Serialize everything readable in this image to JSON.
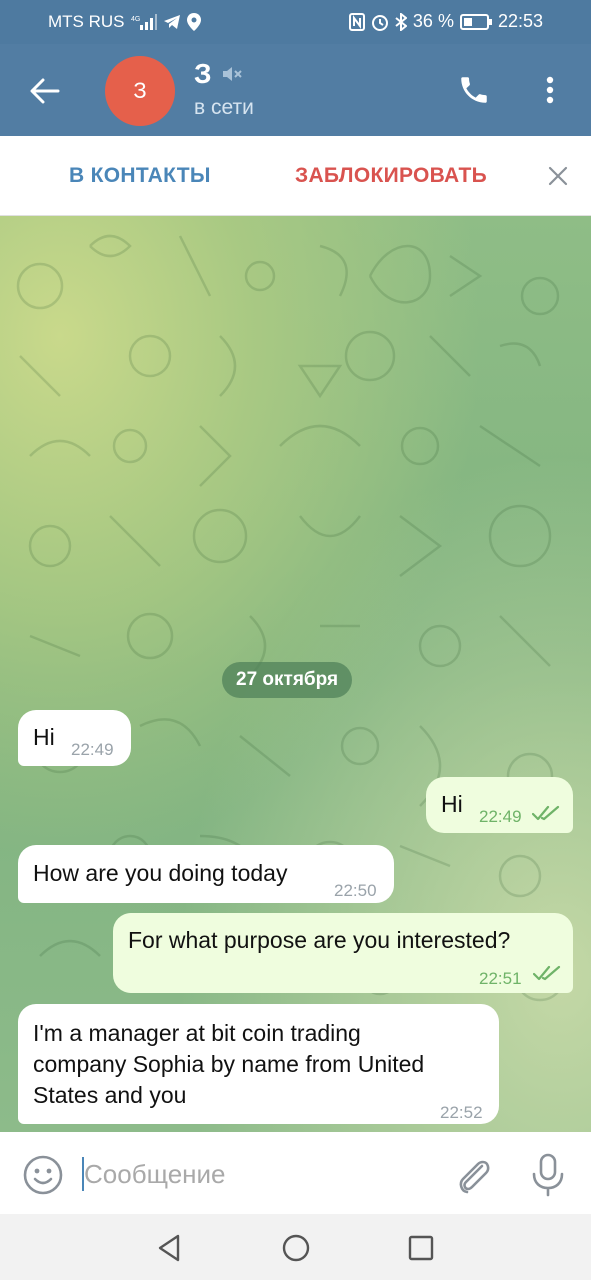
{
  "status_bar": {
    "carrier": "MTS RUS",
    "network": "4G",
    "battery": "36 %",
    "time": "22:53"
  },
  "header": {
    "avatar_initial": "З",
    "chat_name": "З",
    "status": "в сети",
    "muted_icon": "muted-speaker-icon"
  },
  "action_bar": {
    "add_contact": "В КОНТАКТЫ",
    "block": "ЗАБЛОКИРОВАТЬ"
  },
  "chat": {
    "date_separator": "27 октября",
    "messages": [
      {
        "direction": "incoming",
        "text": "Hi",
        "time": "22:49"
      },
      {
        "direction": "outgoing",
        "text": "Hi",
        "time": "22:49",
        "read": true
      },
      {
        "direction": "incoming",
        "text": "How are you doing today",
        "time": "22:50"
      },
      {
        "direction": "outgoing",
        "text": "For what purpose are you interested?",
        "time": "22:51",
        "read": true
      },
      {
        "direction": "incoming",
        "text_lines": [
          "I'm a manager at bit coin trading",
          "company Sophia by name from United",
          "States and you"
        ],
        "time": "22:52"
      }
    ]
  },
  "composer": {
    "placeholder": "Сообщение",
    "value": ""
  },
  "colors": {
    "header": "#527da3",
    "avatar": "#e5604b",
    "add_contact": "#4a86b8",
    "block": "#d9534f",
    "outgoing_bubble": "#effdde",
    "read_ticks": "#6fb368"
  }
}
